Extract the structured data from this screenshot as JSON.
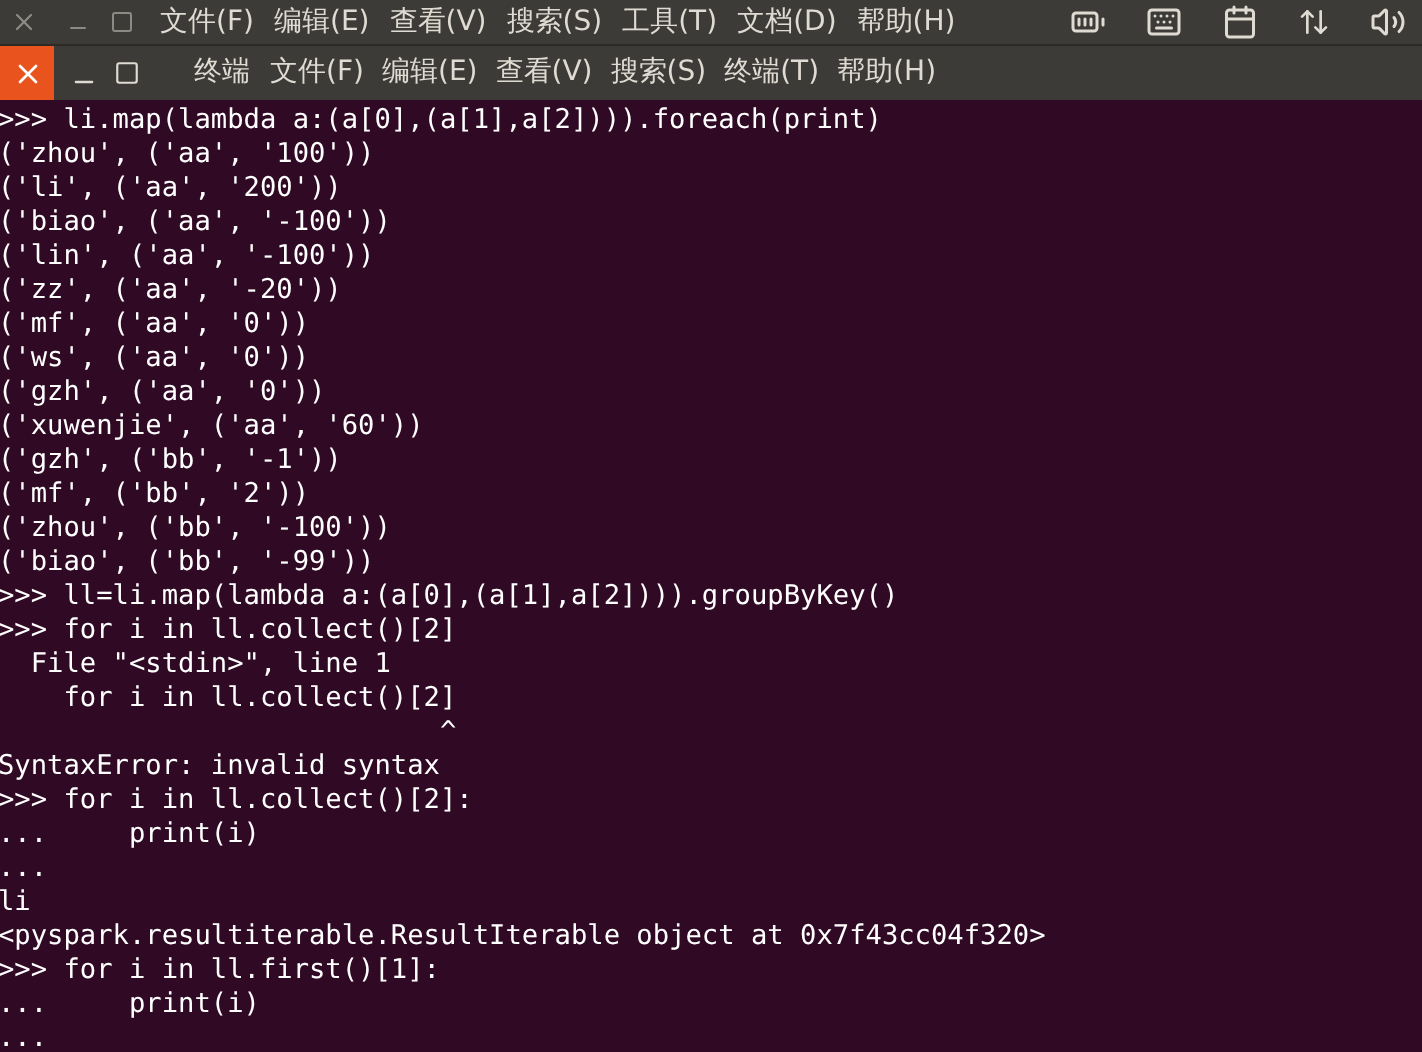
{
  "top_menu": [
    "文件(F)",
    "编辑(E)",
    "查看(V)",
    "搜索(S)",
    "工具(T)",
    "文档(D)",
    "帮助(H)"
  ],
  "window": {
    "title": "终端",
    "menu": [
      "文件(F)",
      "编辑(E)",
      "查看(V)",
      "搜索(S)",
      "终端(T)",
      "帮助(H)"
    ]
  },
  "terminal_lines": [
    ">>> li.map(lambda a:(a[0],(a[1],a[2]))).foreach(print)",
    "('zhou', ('aa', '100'))",
    "('li', ('aa', '200'))",
    "('biao', ('aa', '-100'))",
    "('lin', ('aa', '-100'))",
    "('zz', ('aa', '-20'))",
    "('mf', ('aa', '0'))",
    "('ws', ('aa', '0'))",
    "('gzh', ('aa', '0'))",
    "('xuwenjie', ('aa', '60'))",
    "('gzh', ('bb', '-1'))",
    "('mf', ('bb', '2'))",
    "('zhou', ('bb', '-100'))",
    "('biao', ('bb', '-99'))",
    ">>> ll=li.map(lambda a:(a[0],(a[1],a[2]))).groupByKey()",
    ">>> for i in ll.collect()[2]",
    "  File \"<stdin>\", line 1",
    "    for i in ll.collect()[2]",
    "                           ^",
    "SyntaxError: invalid syntax",
    ">>> for i in ll.collect()[2]:",
    "...     print(i)",
    "...",
    "li",
    "<pyspark.resultiterable.ResultIterable object at 0x7f43cc04f320>",
    ">>> for i in ll.first()[1]:",
    "...     print(i)",
    "..."
  ]
}
